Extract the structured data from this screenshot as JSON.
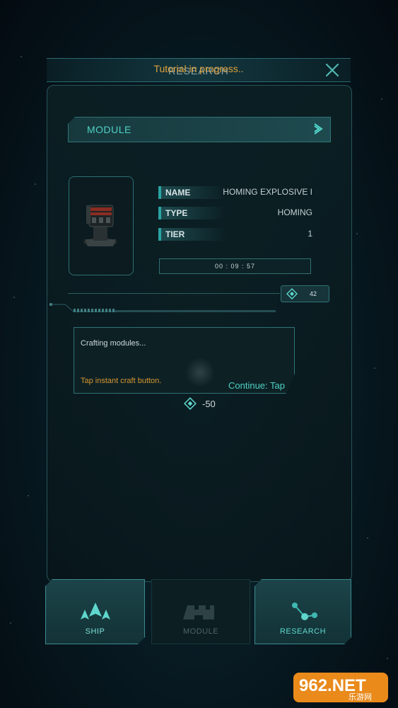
{
  "header": {
    "title": "RESEARCH",
    "tutorial_text": "Tutorial in progress.."
  },
  "module_selector": {
    "label": "MODULE"
  },
  "item": {
    "stats": [
      {
        "label": "NAME",
        "value": "HOMING EXPLOSIVE I"
      },
      {
        "label": "TYPE",
        "value": "HOMING"
      },
      {
        "label": "TIER",
        "value": "1"
      }
    ],
    "timer": "00 : 09 : 57"
  },
  "cost_badge": {
    "value": "42"
  },
  "dialog": {
    "message": "Crafting modules...",
    "hint": "Tap instant craft button.",
    "continue": "Continue: Tap"
  },
  "price": {
    "value": "-50"
  },
  "nav": {
    "ship": "SHIP",
    "module": "MODULE",
    "research": "RESEARCH"
  },
  "watermark": {
    "text": "962.NET",
    "subtext": "乐游网"
  },
  "colors": {
    "accent": "#4fd1c5",
    "warning": "#e0a23a",
    "border": "#2f7478"
  }
}
